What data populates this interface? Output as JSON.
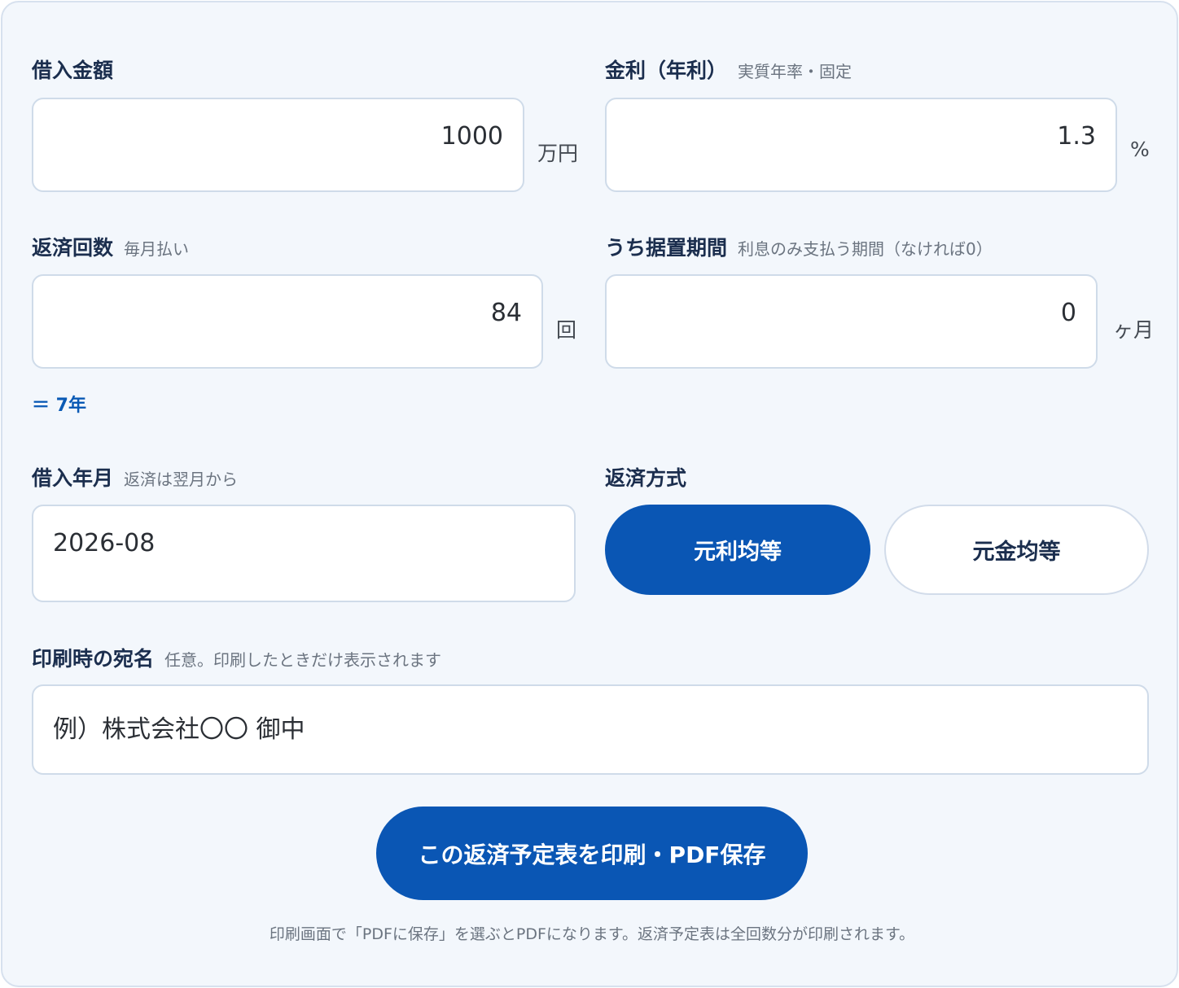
{
  "loan_amount": {
    "label": "借入金額",
    "value": "1000",
    "unit": "万円"
  },
  "interest_rate": {
    "label": "金利（年利）",
    "hint": "実質年率・固定",
    "value": "1.3",
    "unit": "%"
  },
  "repayment_count": {
    "label": "返済回数",
    "hint": "毎月払い",
    "value": "84",
    "unit": "回",
    "years": "＝ 7年"
  },
  "grace_period": {
    "label": "うち据置期間",
    "hint": "利息のみ支払う期間（なければ0）",
    "value": "0",
    "unit": "ヶ月"
  },
  "borrow_month": {
    "label": "借入年月",
    "hint": "返済は翌月から",
    "value": "2026-08"
  },
  "repayment_method": {
    "label": "返済方式",
    "options": [
      "元利均等",
      "元金均等"
    ],
    "selected": "元利均等"
  },
  "addressee": {
    "label": "印刷時の宛名",
    "hint": "任意。印刷したときだけ表示されます",
    "placeholder": "例）株式会社〇〇 御中"
  },
  "print_button": {
    "label": "この返済予定表を印刷・PDF保存"
  },
  "note": "印刷画面で「PDFに保存」を選ぶとPDFになります。返済予定表は全回数分が印刷されます。",
  "colors": {
    "accent": "#0a56b4",
    "panel_bg": "#f3f7fc",
    "label": "#1b2e4e",
    "hint": "#6b7480"
  }
}
